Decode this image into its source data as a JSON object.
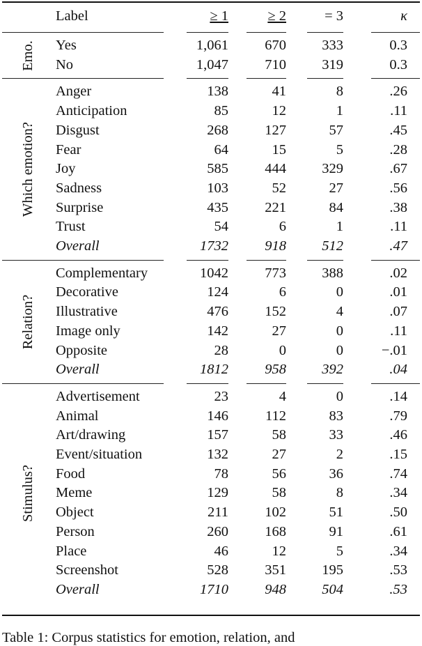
{
  "header": {
    "label": "Label",
    "col1": "≥ 1",
    "col2": "≥ 2",
    "col3": "= 3",
    "col4": "κ"
  },
  "groups": [
    {
      "name": "Emo.",
      "rows": [
        {
          "label": "Yes",
          "c1": "1,061",
          "c2": "670",
          "c3": "333",
          "kappa": "0.3"
        },
        {
          "label": "No",
          "c1": "1,047",
          "c2": "710",
          "c3": "319",
          "kappa": "0.3"
        }
      ]
    },
    {
      "name": "Which emotion?",
      "rows": [
        {
          "label": "Anger",
          "c1": "138",
          "c2": "41",
          "c3": "8",
          "kappa": ".26"
        },
        {
          "label": "Anticipation",
          "c1": "85",
          "c2": "12",
          "c3": "1",
          "kappa": ".11"
        },
        {
          "label": "Disgust",
          "c1": "268",
          "c2": "127",
          "c3": "57",
          "kappa": ".45"
        },
        {
          "label": "Fear",
          "c1": "64",
          "c2": "15",
          "c3": "5",
          "kappa": ".28"
        },
        {
          "label": "Joy",
          "c1": "585",
          "c2": "444",
          "c3": "329",
          "kappa": ".67"
        },
        {
          "label": "Sadness",
          "c1": "103",
          "c2": "52",
          "c3": "27",
          "kappa": ".56"
        },
        {
          "label": "Surprise",
          "c1": "435",
          "c2": "221",
          "c3": "84",
          "kappa": ".38"
        },
        {
          "label": "Trust",
          "c1": "54",
          "c2": "6",
          "c3": "1",
          "kappa": ".11"
        },
        {
          "label": "Overall",
          "c1": "1732",
          "c2": "918",
          "c3": "512",
          "kappa": ".47",
          "italic": true
        }
      ]
    },
    {
      "name": "Relation?",
      "rows": [
        {
          "label": "Complementary",
          "c1": "1042",
          "c2": "773",
          "c3": "388",
          "kappa": ".02"
        },
        {
          "label": "Decorative",
          "c1": "124",
          "c2": "6",
          "c3": "0",
          "kappa": ".01"
        },
        {
          "label": "Illustrative",
          "c1": "476",
          "c2": "152",
          "c3": "4",
          "kappa": ".07"
        },
        {
          "label": "Image only",
          "c1": "142",
          "c2": "27",
          "c3": "0",
          "kappa": ".11"
        },
        {
          "label": "Opposite",
          "c1": "28",
          "c2": "0",
          "c3": "0",
          "kappa": "−.01"
        },
        {
          "label": "Overall",
          "c1": "1812",
          "c2": "958",
          "c3": "392",
          "kappa": ".04",
          "italic": true
        }
      ]
    },
    {
      "name": "Stimulus?",
      "rows": [
        {
          "label": "Advertisement",
          "c1": "23",
          "c2": "4",
          "c3": "0",
          "kappa": ".14"
        },
        {
          "label": "Animal",
          "c1": "146",
          "c2": "112",
          "c3": "83",
          "kappa": ".79"
        },
        {
          "label": "Art/drawing",
          "c1": "157",
          "c2": "58",
          "c3": "33",
          "kappa": ".46"
        },
        {
          "label": "Event/situation",
          "c1": "132",
          "c2": "27",
          "c3": "2",
          "kappa": ".15"
        },
        {
          "label": "Food",
          "c1": "78",
          "c2": "56",
          "c3": "36",
          "kappa": ".74"
        },
        {
          "label": "Meme",
          "c1": "129",
          "c2": "58",
          "c3": "8",
          "kappa": ".34"
        },
        {
          "label": "Object",
          "c1": "211",
          "c2": "102",
          "c3": "51",
          "kappa": ".50"
        },
        {
          "label": "Person",
          "c1": "260",
          "c2": "168",
          "c3": "91",
          "kappa": ".61"
        },
        {
          "label": "Place",
          "c1": "46",
          "c2": "12",
          "c3": "5",
          "kappa": ".34"
        },
        {
          "label": "Screenshot",
          "c1": "528",
          "c2": "351",
          "c3": "195",
          "kappa": ".53"
        },
        {
          "label": "Overall",
          "c1": "1710",
          "c2": "948",
          "c3": "504",
          "kappa": ".53",
          "italic": true
        }
      ]
    }
  ],
  "caption": "Table 1: Corpus statistics for emotion, relation, and"
}
